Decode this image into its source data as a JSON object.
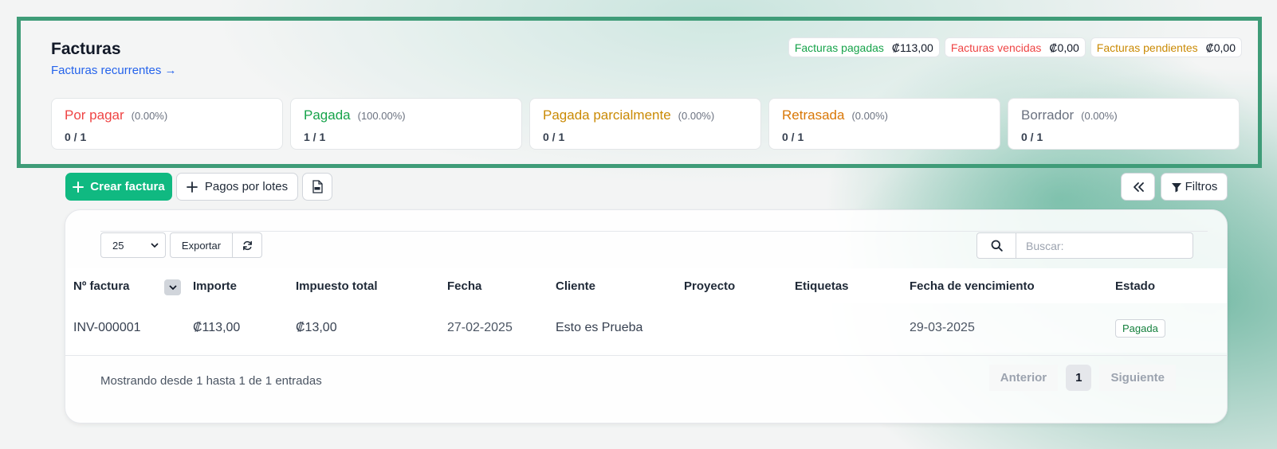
{
  "header": {
    "title": "Facturas",
    "recurring_link": "Facturas recurrentes →"
  },
  "totals": [
    {
      "label": "Facturas pagadas",
      "amount": "₡113,00",
      "color": "#16a34a"
    },
    {
      "label": "Facturas vencidas",
      "amount": "₡0,00",
      "color": "#ef4444"
    },
    {
      "label": "Facturas pendientes",
      "amount": "₡0,00",
      "color": "#ca8a04"
    }
  ],
  "status_cards": [
    {
      "name": "Por pagar",
      "percent": "(0.00%)",
      "count": "0 / 1",
      "color": "#ef4444"
    },
    {
      "name": "Pagada",
      "percent": "(100.00%)",
      "count": "1 / 1",
      "color": "#16a34a"
    },
    {
      "name": "Pagada parcialmente",
      "percent": "(0.00%)",
      "count": "0 / 1",
      "color": "#ca8a04"
    },
    {
      "name": "Retrasada",
      "percent": "(0.00%)",
      "count": "0 / 1",
      "color": "#d97706"
    },
    {
      "name": "Borrador",
      "percent": "(0.00%)",
      "count": "0 / 1",
      "color": "#6b7280"
    }
  ],
  "toolbar": {
    "create_label": "Crear factura",
    "batch_label": "Pagos por lotes",
    "filters_label": "Filtros"
  },
  "table_controls": {
    "page_size": "25",
    "export_label": "Exportar",
    "search_placeholder": "Buscar:"
  },
  "table": {
    "columns": [
      "Nº factura",
      "Importe",
      "Impuesto total",
      "Fecha",
      "Cliente",
      "Proyecto",
      "Etiquetas",
      "Fecha de vencimiento",
      "Estado"
    ],
    "rows": [
      {
        "number": "INV-000001",
        "amount": "₡113,00",
        "tax": "₡13,00",
        "date": "27-02-2025",
        "client": "Esto es Prueba",
        "project": "",
        "tags": "",
        "due_date": "29-03-2025",
        "status": "Pagada"
      }
    ]
  },
  "footer": {
    "info": "Mostrando desde 1 hasta 1 de 1 entradas",
    "prev_label": "Anterior",
    "current_page": "1",
    "next_label": "Siguiente"
  }
}
